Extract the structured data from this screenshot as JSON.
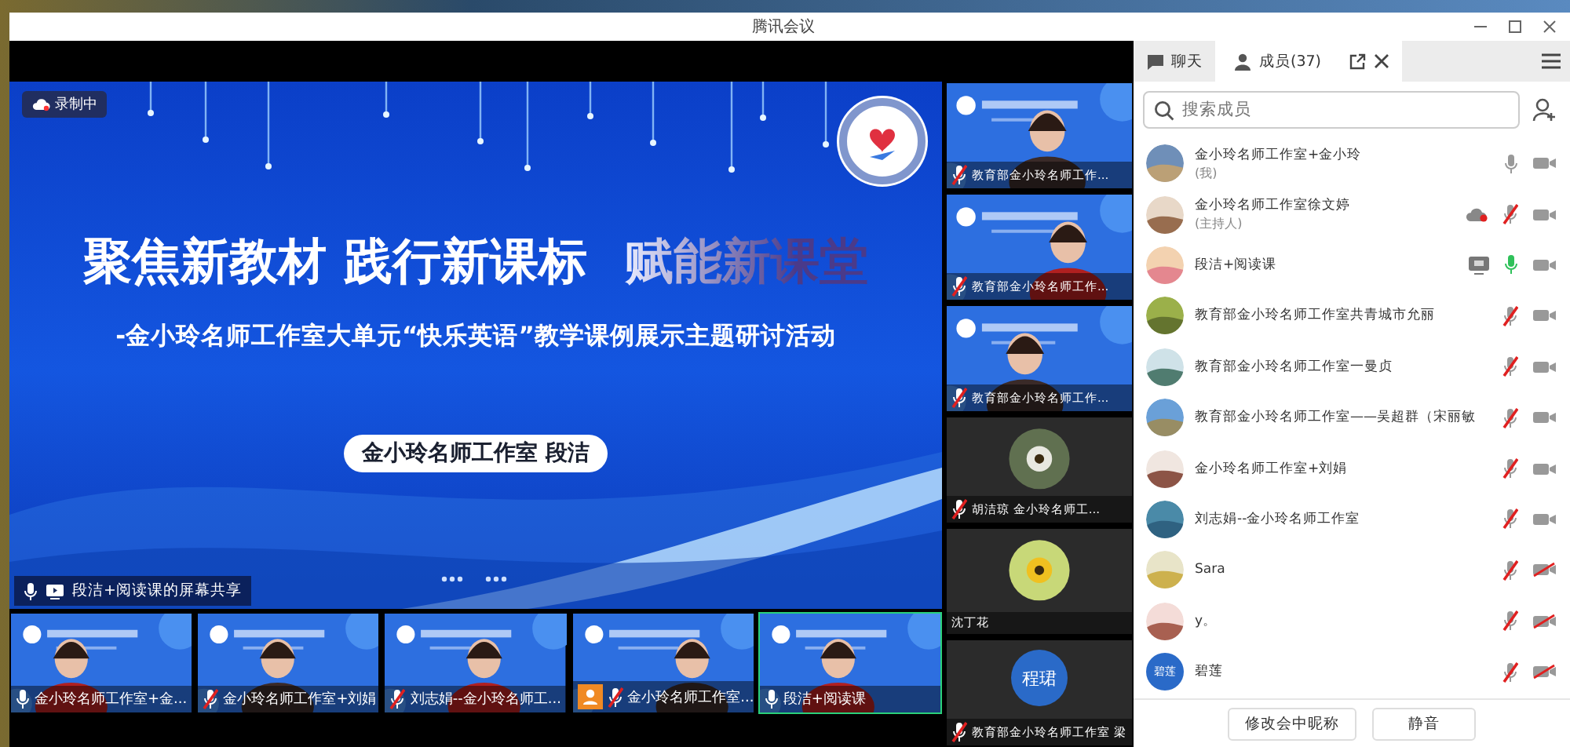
{
  "window": {
    "title": "腾讯会议"
  },
  "slide": {
    "recording": "录制中",
    "title": [
      "聚焦新教材 践行新课标",
      "赋能新课堂"
    ],
    "subtitle": "-金小玲名师工作室大单元“快乐英语”教学课例展示主题研讨活动",
    "presenter": "金小玲名师工作室 段洁",
    "share_label": "段洁+阅读课的屏幕共享"
  },
  "side_tiles": [
    {
      "kind": "video",
      "label": "教育部金小玲名师工作...",
      "mic_shown": true,
      "muted": true
    },
    {
      "kind": "video",
      "label": "教育部金小玲名师工作...",
      "mic_shown": true,
      "muted": true
    },
    {
      "kind": "video",
      "label": "教育部金小玲名师工作...",
      "mic_shown": true,
      "muted": true
    },
    {
      "kind": "avatar",
      "label": "胡洁琼 金小玲名师工...",
      "mic_shown": true,
      "muted": true
    },
    {
      "kind": "avatar",
      "label": "沈丁花",
      "mic_shown": false
    },
    {
      "kind": "initials",
      "avatar_text": "程珺",
      "label": "教育部金小玲名师工作室 梁",
      "mic_shown": true,
      "muted": true
    }
  ],
  "bottom_tiles": [
    {
      "kind": "video",
      "label": "金小玲名师工作室+金...",
      "mic_shown": true,
      "muted": false,
      "badge": false,
      "speaking": false
    },
    {
      "kind": "video",
      "label": "金小玲名师工作室+刘娟",
      "mic_shown": true,
      "muted": true,
      "badge": false,
      "speaking": false
    },
    {
      "kind": "video",
      "label": "刘志娟--金小玲名师工...",
      "mic_shown": true,
      "muted": true,
      "badge": false,
      "speaking": false
    },
    {
      "kind": "video",
      "label": "金小玲名师工作室...",
      "mic_shown": true,
      "muted": true,
      "badge": true,
      "speaking": false
    },
    {
      "kind": "video",
      "label": "段洁+阅读课",
      "mic_shown": true,
      "muted": false,
      "badge": false,
      "speaking": true
    }
  ],
  "panel": {
    "tabs": [
      {
        "label": "聊天",
        "selected": false
      },
      {
        "label": "成员(37)",
        "selected": true
      }
    ],
    "search": {
      "placeholder": "搜索成员"
    },
    "members": [
      {
        "name": "金小玲名师工作室+金小玲",
        "note": "(我)",
        "cloud_recording": false,
        "screen_sharing": false,
        "muted": false,
        "speaking": false,
        "camera_blocked": false
      },
      {
        "name": "金小玲名师工作室徐文婷",
        "note": "(主持人)",
        "cloud_recording": true,
        "screen_sharing": false,
        "muted": true,
        "speaking": false,
        "camera_blocked": false
      },
      {
        "name": "段洁+阅读课",
        "cloud_recording": false,
        "screen_sharing": true,
        "muted": false,
        "speaking": true,
        "camera_blocked": false
      },
      {
        "name": "教育部金小玲名师工作室共青城市允丽",
        "cloud_recording": false,
        "screen_sharing": false,
        "muted": true,
        "speaking": false,
        "camera_blocked": false
      },
      {
        "name": "教育部金小玲名师工作室一曼贞",
        "cloud_recording": false,
        "screen_sharing": false,
        "muted": true,
        "speaking": false,
        "camera_blocked": false
      },
      {
        "name": "教育部金小玲名师工作室——吴超群（宋丽敏",
        "cloud_recording": false,
        "screen_sharing": false,
        "muted": true,
        "speaking": false,
        "camera_blocked": false
      },
      {
        "name": "金小玲名师工作室+刘娟",
        "cloud_recording": false,
        "screen_sharing": false,
        "muted": true,
        "speaking": false,
        "camera_blocked": false
      },
      {
        "name": "刘志娟--金小玲名师工作室",
        "cloud_recording": false,
        "screen_sharing": false,
        "muted": true,
        "speaking": false,
        "camera_blocked": false
      },
      {
        "name": "Sara",
        "cloud_recording": false,
        "screen_sharing": false,
        "muted": true,
        "speaking": false,
        "camera_blocked": true
      },
      {
        "name": "y。",
        "cloud_recording": false,
        "screen_sharing": false,
        "muted": true,
        "speaking": false,
        "camera_blocked": true
      },
      {
        "name": "碧莲",
        "avatar_text": "碧莲",
        "cloud_recording": false,
        "screen_sharing": false,
        "muted": true,
        "speaking": false,
        "camera_blocked": true
      }
    ],
    "buttons": [
      "修改会中昵称",
      "静音"
    ]
  }
}
